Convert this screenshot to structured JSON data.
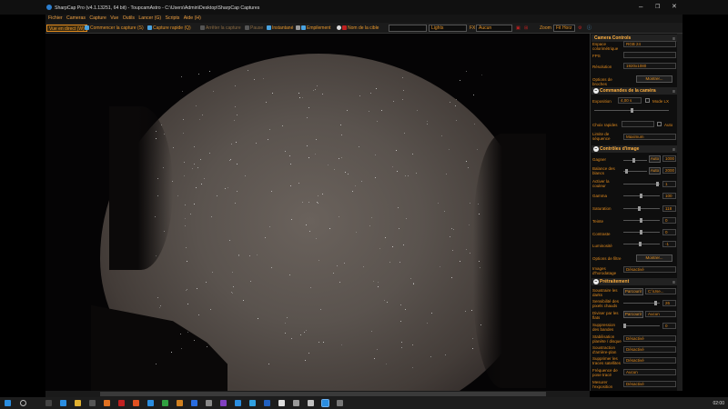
{
  "window": {
    "title": "SharpCap Pro (v4.1.13251, 64 bit) - ToupcamAstro - C:\\Users\\Admin\\Desktop\\SharpCap Captures"
  },
  "menu": [
    "Fichier",
    "Cameras",
    "Capture",
    "Vue",
    "Outils",
    "Lancer (G)",
    "Scripts",
    "Aide (H)"
  ],
  "toolbar": {
    "live_view": "Vue en direct (W)",
    "start_capture": "Commencer la capture (S)",
    "quick_capture": "Capture rapide (Q)",
    "stop_capture": "Arrêter la capture",
    "pause": "Pause",
    "snapshot": "Instantané",
    "stacking": "Empilement",
    "target_name_label": "Nom de la cible",
    "target_name_value": "",
    "lights_value": "Lights",
    "fx_label": "FX",
    "fx_value": "Aucun",
    "zoom_label": "Zoom",
    "zoom_value": "Fit Horz"
  },
  "panel": {
    "camera_controls": {
      "header": "Camera Controls",
      "color_space_label": "Espace colorimétrique",
      "color_space_value": "RGB 24",
      "fps_label": "FPS",
      "fps_value": "",
      "resolution_label": "Résolution",
      "resolution_value": "1920x1080",
      "brochure_label": "Options de broches",
      "brochure_button": "Montrer..."
    },
    "camera_command": {
      "header": "Commandes de la caméra",
      "exposure_label": "Exposition",
      "exposure_value": "4,00 s",
      "lx_mode_label": "Mode LX",
      "quick_choice_label": "Choix rapides",
      "auto_label": "Auto",
      "frame_limit_label": "Limite de séquence",
      "frame_limit_value": "Maximum"
    },
    "image_controls": {
      "header": "Contrôles d'image",
      "gain_label": "Gagner",
      "gain_auto": "Auto",
      "gain_value": "1000",
      "wb_label": "Balance des blancs",
      "wb_auto": "Auto",
      "wb_value": "2000",
      "color_label": "Activer la couleur",
      "color_value": "1",
      "gamma_label": "Gamma",
      "gamma_value": "100",
      "saturation_label": "Saturation",
      "saturation_value": "118",
      "hue_label": "Teinte",
      "hue_value": "0",
      "contrast_label": "Contraste",
      "contrast_value": "0",
      "brightness_label": "Luminosité",
      "brightness_value": "-1",
      "filter_label": "Options de filtre",
      "filter_button": "Montrer...",
      "timestamp_label": "Images d'horodatage",
      "timestamp_value": "Désactivé"
    },
    "preprocessing": {
      "header": "Prétraitement",
      "subtract_dark_label": "Soustraire les darks",
      "subtract_dark_button": "Parcourir",
      "subtract_dark_value": "C:\\Use...",
      "hot_pixel_label": "Sensibilité des pixels chauds",
      "hot_pixel_value": "26",
      "flat_label": "Diviser par les flats",
      "flat_button": "Parcourir",
      "flat_value": "Aucun",
      "banding_label": "Suppression des bandes",
      "banding_value": "0",
      "stabilization_label": "Stabilisation planète / disque",
      "stabilization_value": "Désactivé",
      "bg_subtract_label": "Soustraction d'arrière-plan",
      "bg_subtract_value": "Désactivé",
      "satellite_label": "Supprimer les traces satellites",
      "satellite_value": "Désactivé",
      "tracking_label": "Fréquence de pose tracé",
      "tracking_value": "Aucun",
      "auto_exposure_label": "Mesurer l'exposition",
      "auto_exposure_value": "Désactivé"
    }
  },
  "taskbar": {
    "clock": "02:00"
  },
  "colors": {
    "accent": "#e08a1e",
    "panel_bg": "#0e0e0e",
    "titlebar": "#101010"
  }
}
